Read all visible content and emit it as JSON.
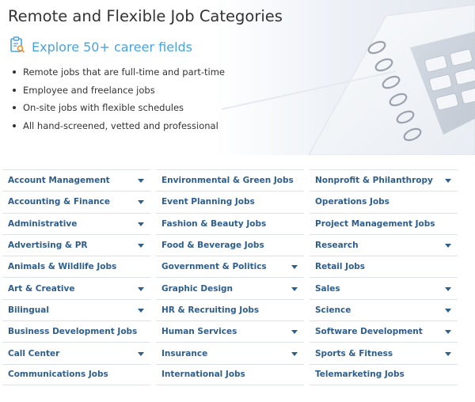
{
  "header": {
    "title": "Remote and Flexible Job Categories",
    "explore_text": "Explore 50+ career fields",
    "explore_icon": "clipboard-search-icon",
    "accent_color": "#4aa3df",
    "bullets": [
      "Remote jobs that are full-time and part-time",
      "Employee and freelance jobs",
      "On-site jobs with flexible schedules",
      "All hand-screened, vetted and professional"
    ]
  },
  "categories": {
    "link_color": "#2e5e8c",
    "columns": [
      [
        {
          "label": "Account Management",
          "has_dropdown": true
        },
        {
          "label": "Accounting & Finance",
          "has_dropdown": true
        },
        {
          "label": "Administrative",
          "has_dropdown": true
        },
        {
          "label": "Advertising & PR",
          "has_dropdown": true
        },
        {
          "label": "Animals & Wildlife Jobs",
          "has_dropdown": false
        },
        {
          "label": "Art & Creative",
          "has_dropdown": true
        },
        {
          "label": "Bilingual",
          "has_dropdown": true
        },
        {
          "label": "Business Development Jobs",
          "has_dropdown": false
        },
        {
          "label": "Call Center",
          "has_dropdown": true
        },
        {
          "label": "Communications Jobs",
          "has_dropdown": false
        }
      ],
      [
        {
          "label": "Environmental & Green Jobs",
          "has_dropdown": false
        },
        {
          "label": "Event Planning Jobs",
          "has_dropdown": false
        },
        {
          "label": "Fashion & Beauty Jobs",
          "has_dropdown": false
        },
        {
          "label": "Food & Beverage Jobs",
          "has_dropdown": false
        },
        {
          "label": "Government & Politics",
          "has_dropdown": true
        },
        {
          "label": "Graphic Design",
          "has_dropdown": true
        },
        {
          "label": "HR & Recruiting Jobs",
          "has_dropdown": false
        },
        {
          "label": "Human Services",
          "has_dropdown": true
        },
        {
          "label": "Insurance",
          "has_dropdown": true
        },
        {
          "label": "International Jobs",
          "has_dropdown": false
        }
      ],
      [
        {
          "label": "Nonprofit & Philanthropy",
          "has_dropdown": true
        },
        {
          "label": "Operations Jobs",
          "has_dropdown": false
        },
        {
          "label": "Project Management Jobs",
          "has_dropdown": false
        },
        {
          "label": "Research",
          "has_dropdown": true
        },
        {
          "label": "Retail Jobs",
          "has_dropdown": false
        },
        {
          "label": "Sales",
          "has_dropdown": true
        },
        {
          "label": "Science",
          "has_dropdown": true
        },
        {
          "label": "Software Development",
          "has_dropdown": true
        },
        {
          "label": "Sports & Fitness",
          "has_dropdown": true
        },
        {
          "label": "Telemarketing Jobs",
          "has_dropdown": false
        }
      ]
    ]
  }
}
